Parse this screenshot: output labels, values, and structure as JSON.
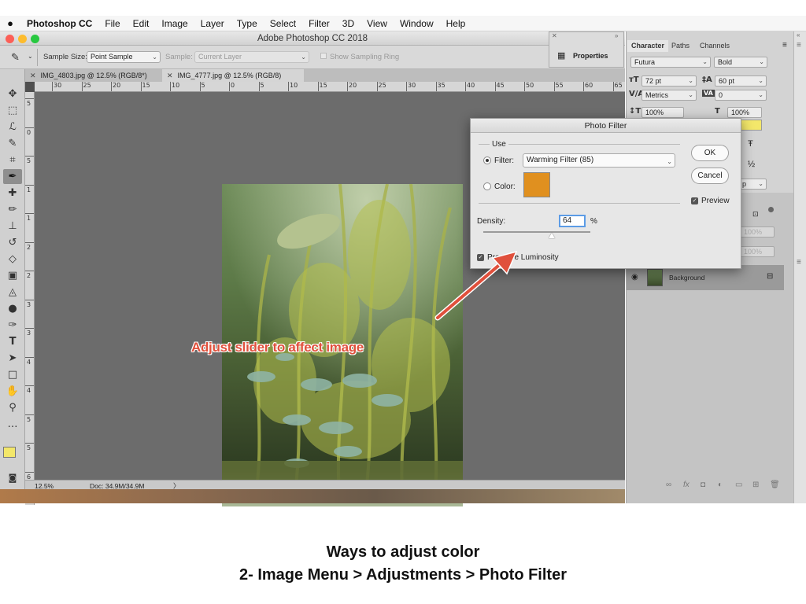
{
  "menubar": {
    "apple": "",
    "app": "Photoshop CC",
    "items": [
      "File",
      "Edit",
      "Image",
      "Layer",
      "Type",
      "Select",
      "Filter",
      "3D",
      "View",
      "Window",
      "Help"
    ]
  },
  "window": {
    "title": "Adobe Photoshop CC 2018"
  },
  "options": {
    "sample_size_label": "Sample Size:",
    "sample_size_value": "Point Sample",
    "sample_label": "Sample:",
    "sample_value": "Current Layer",
    "show_ring": "Show Sampling Ring"
  },
  "tabs": [
    {
      "label": "IMG_4803.jpg @ 12.5% (RGB/8*)"
    },
    {
      "label": "IMG_4777.jpg @ 12.5% (RGB/8)"
    }
  ],
  "ruler": {
    "top_labels": [
      "30",
      "25",
      "20",
      "15",
      "10",
      "5",
      "0",
      "5",
      "10",
      "15",
      "20",
      "25",
      "30",
      "35",
      "40",
      "45",
      "50",
      "55",
      "60",
      "65"
    ],
    "left_labels": [
      "5",
      "0",
      "5",
      "1",
      "1",
      "2",
      "2",
      "3",
      "3",
      "4",
      "4",
      "5",
      "5",
      "6"
    ]
  },
  "status": {
    "zoom": "12.5%",
    "doc": "Doc: 34.9M/34.9M",
    "arrow": "〉"
  },
  "properties": {
    "label": "Properties"
  },
  "character": {
    "tabs": [
      "Character",
      "Paths",
      "Channels"
    ],
    "font": "Futura",
    "style": "Bold",
    "size": "72 pt",
    "leading": "60 pt",
    "kerning": "Metrics",
    "tracking": "0",
    "vscale": "100%",
    "hscale": "100%",
    "color": "#f3e76a",
    "frac": "½",
    "partial": "p"
  },
  "layers": {
    "opacity1": "100%",
    "opacity2": "100%",
    "background_label": "Background"
  },
  "dialog": {
    "title": "Photo Filter",
    "use_label": "Use",
    "filter_label": "Filter:",
    "filter_value": "Warming Filter (85)",
    "color_label": "Color:",
    "swatch": "#e0901f",
    "ok": "OK",
    "cancel": "Cancel",
    "preview": "Preview",
    "density_label": "Density:",
    "density_value": "64",
    "density_unit": "%",
    "density_fraction": 0.64,
    "preserve": "Preserve Luminosity"
  },
  "annotation": "Adjust slider to affect image",
  "caption": {
    "line1": "Ways to adjust color",
    "line2": "2- Image Menu > Adjustments > Photo Filter"
  },
  "colors": {
    "arrow": "#e0503c",
    "foreground": "#f3e76a"
  }
}
